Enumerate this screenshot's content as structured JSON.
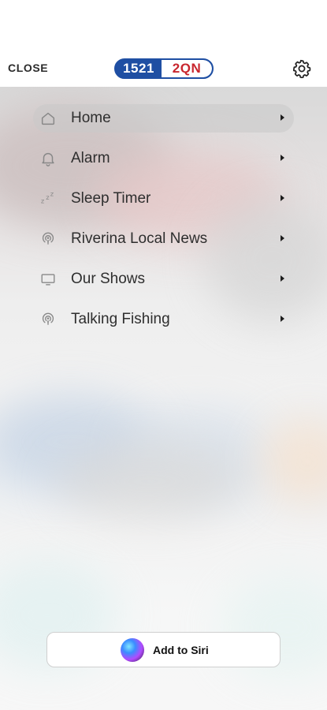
{
  "header": {
    "close_label": "CLOSE",
    "logo_left": "1521",
    "logo_right": "2QN",
    "settings_icon": "gear-icon"
  },
  "menu": {
    "items": [
      {
        "label": "Home",
        "icon": "home-icon",
        "active": true
      },
      {
        "label": "Alarm",
        "icon": "bell-icon",
        "active": false
      },
      {
        "label": "Sleep Timer",
        "icon": "sleep-zzz-icon",
        "active": false
      },
      {
        "label": "Riverina Local News",
        "icon": "podcast-icon",
        "active": false
      },
      {
        "label": "Our Shows",
        "icon": "monitor-icon",
        "active": false
      },
      {
        "label": "Talking Fishing",
        "icon": "podcast-icon",
        "active": false
      }
    ]
  },
  "siri": {
    "label": "Add to Siri",
    "icon": "siri-orb-icon"
  },
  "colors": {
    "logo_blue": "#1f4fa3",
    "logo_red": "#c8262e",
    "text": "#2e2e2e",
    "active_pill": "#c8c8c8"
  }
}
